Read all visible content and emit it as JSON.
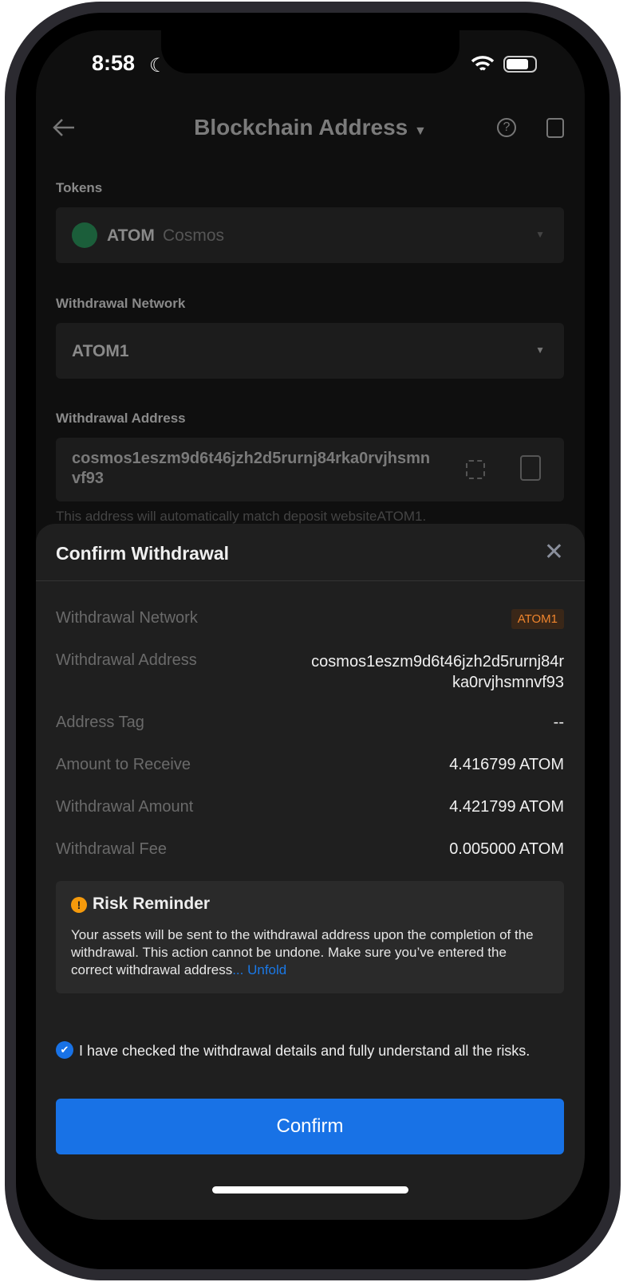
{
  "status_bar": {
    "time": "8:58"
  },
  "header": {
    "title": "Blockchain Address"
  },
  "form": {
    "tokens_label": "Tokens",
    "token_symbol": "ATOM",
    "token_name": "Cosmos",
    "network_label": "Withdrawal Network",
    "network_value": "ATOM1",
    "address_label": "Withdrawal Address",
    "address_value": "cosmos1eszm9d6t46jzh2d5rurnj84rka0rvjhsmnvf93",
    "address_hint": "This address will automatically match deposit websiteATOM1."
  },
  "sheet": {
    "title": "Confirm Withdrawal",
    "rows": [
      {
        "label": "Withdrawal Network",
        "value": "ATOM1"
      },
      {
        "label": "Withdrawal Address",
        "value": "cosmos1eszm9d6t46jzh2d5rurnj84rka0rvjhsmnvf93"
      },
      {
        "label": "Address Tag",
        "value": "--"
      },
      {
        "label": "Amount to Receive",
        "value": "4.416799 ATOM"
      },
      {
        "label": "Withdrawal Amount",
        "value": "4.421799 ATOM"
      },
      {
        "label": "Withdrawal Fee",
        "value": "0.005000 ATOM"
      }
    ],
    "risk": {
      "title": "Risk Reminder",
      "text": "Your assets will be sent to the withdrawal address upon the completion of the withdrawal. This action cannot be undone. Make sure you’ve entered the correct withdrawal address",
      "more": "... Unfold"
    },
    "checkbox_label": "I have checked the withdrawal details and fully understand all the risks.",
    "checkbox_checked": true,
    "confirm_label": "Confirm"
  },
  "colors": {
    "accent": "#1872e6",
    "network_badge": "#f0852d",
    "warning": "#f59a0c"
  }
}
